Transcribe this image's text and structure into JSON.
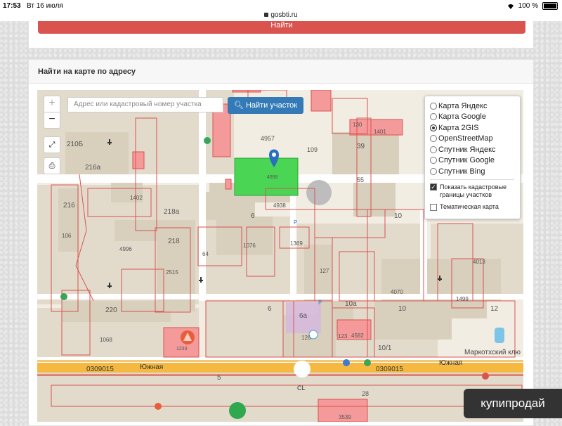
{
  "status_bar": {
    "time": "17:53",
    "date": "Вт 16 июля",
    "url": "gosbti.ru",
    "battery": "100 %"
  },
  "top_button": "Найти",
  "card": {
    "title": "Найти на карте по адресу"
  },
  "map": {
    "search": {
      "placeholder": "Адрес или кадастровый номер участка",
      "button": "Найти участок"
    },
    "zoom_in": "+",
    "zoom_out": "−",
    "layers": [
      {
        "label": "Карта Яндекс",
        "selected": false
      },
      {
        "label": "Карта Google",
        "selected": false
      },
      {
        "label": "Карта 2GIS",
        "selected": true
      },
      {
        "label": "OpenStreetMap",
        "selected": false
      },
      {
        "label": "Спутник Яндекс",
        "selected": false
      },
      {
        "label": "Спутник Google",
        "selected": false
      },
      {
        "label": "Спутник Bing",
        "selected": false
      }
    ],
    "options": [
      {
        "label": "Показать кадастровые границы участков",
        "checked": true
      },
      {
        "label": "Тематическая карта",
        "checked": false
      }
    ],
    "labels": {
      "l4957": "4957",
      "l109": "109",
      "l39": "39",
      "l55": "55",
      "l210b": "210Б",
      "l216a": "216а",
      "l216": "216",
      "l1402": "1402",
      "l218a": "218а",
      "l4938": "4938",
      "l6a1": "6",
      "l10a": "10",
      "l106": "106",
      "l4996": "4996",
      "l218": "218",
      "l64": "64",
      "l1076": "1076",
      "l1369": "1369",
      "l2515": "2515",
      "l4070": "4070",
      "l4013": "4013",
      "l220": "220",
      "l6b": "6",
      "l10c": "10а",
      "l10d": "10",
      "l12": "12",
      "l1068": "1068",
      "l6a": "6а",
      "l126": "126",
      "l123": "123",
      "l4582": "4582",
      "l130": "130",
      "l1401": "1401",
      "l127": "127",
      "l1499": "1499",
      "l101": "10/1",
      "l5": "5",
      "l28": "28",
      "l3539": "3539",
      "l4958": "4958",
      "l1233": "1233",
      "street1": "Южная",
      "street2": "Южная",
      "cad1": "0309015",
      "cad2": "0309015",
      "poi": "Маркотхский клю",
      "cl": "CL",
      "p1": "P",
      "p2": "P"
    }
  },
  "watermark": "купипродай"
}
